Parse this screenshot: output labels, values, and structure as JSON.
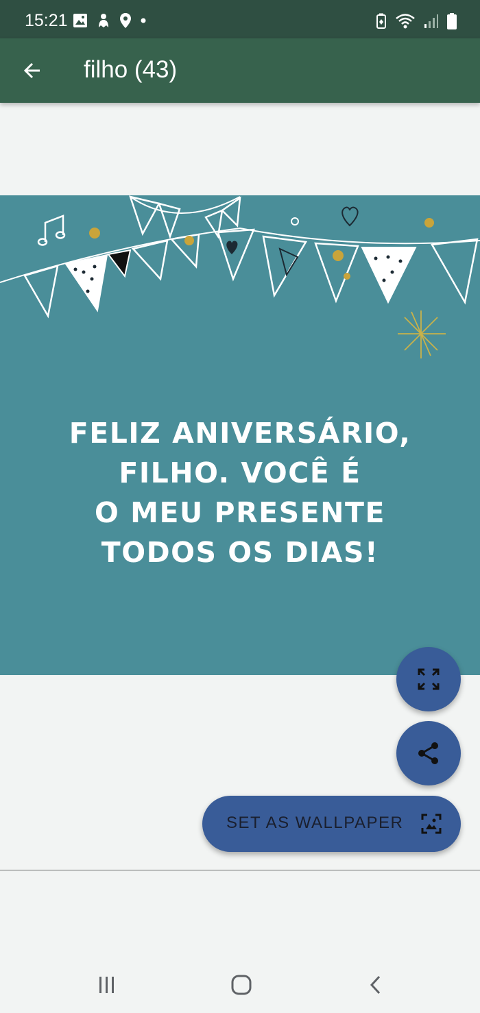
{
  "status_bar": {
    "time": "15:21",
    "left_icons": [
      "image-icon",
      "ghost-icon",
      "location-pin-icon",
      "dot-icon"
    ],
    "right_icons": [
      "battery-saver-icon",
      "wifi-icon",
      "signal-icon",
      "battery-icon"
    ]
  },
  "app_bar": {
    "back_icon": "arrow-left-icon",
    "title": "filho (43)",
    "background": "#37624d"
  },
  "image": {
    "background": "#4a8e99",
    "text_lines": [
      "FELIZ ANIVERSÁRIO,",
      "FILHO. VOCÊ É",
      "O MEU PRESENTE",
      "TODOS OS DIAS!"
    ]
  },
  "actions": {
    "fullscreen_icon": "expand-icon",
    "share_icon": "share-icon",
    "wallpaper_label": "SET AS WALLPAPER",
    "wallpaper_icon": "wallpaper-icon",
    "accent": "#395c98"
  },
  "nav_bar": {
    "icons": [
      "recent-apps-icon",
      "home-icon",
      "back-icon"
    ]
  }
}
